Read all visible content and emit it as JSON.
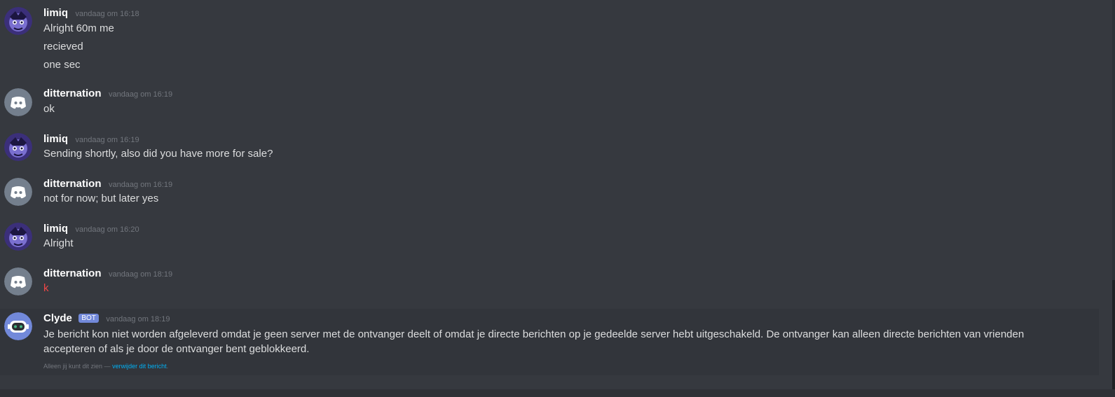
{
  "messages": [
    {
      "user": "limiq",
      "time": "vandaag om 16:18",
      "lines": [
        "Alright 60m me",
        "recieved",
        "one sec"
      ]
    },
    {
      "user": "ditternation",
      "time": "vandaag om 16:19",
      "lines": [
        "ok"
      ]
    },
    {
      "user": "limiq",
      "time": "vandaag om 16:19",
      "lines": [
        "Sending shortly, also did you have more for sale?"
      ]
    },
    {
      "user": "ditternation",
      "time": "vandaag om 16:19",
      "lines": [
        "not for now; but later yes"
      ]
    },
    {
      "user": "limiq",
      "time": "vandaag om 16:20",
      "lines": [
        "Alright"
      ]
    },
    {
      "user": "ditternation",
      "time": "vandaag om 18:19",
      "lines": [
        "k"
      ]
    }
  ],
  "clyde": {
    "user": "Clyde",
    "badge": "BOT",
    "time": "vandaag om 18:19",
    "text": "Je bericht kon niet worden afgeleverd omdat je geen server met de ontvanger deelt of omdat je directe berichten op je gedeelde server hebt uitgeschakeld. De ontvanger kan alleen directe berichten van vrienden accepteren of als je door de ontvanger bent geblokkeerd.",
    "ephemeral_note": "Alleen jij kunt dit zien —",
    "delete_link": "verwijder dit bericht",
    "delete_suffix": "."
  },
  "colors": {
    "background": "#36393f",
    "username": "#ffffff",
    "timestamp": "#72767d",
    "text": "#dcddde",
    "red_text": "#f04747",
    "bot_badge": "#7289da",
    "discord_avatar": "#747f8d",
    "link": "#00b0f4"
  },
  "icons": {
    "limiq_avatar": "anime-avatar",
    "ditternation_avatar": "discord-logo-avatar",
    "clyde_avatar": "clyde-robot-avatar"
  }
}
